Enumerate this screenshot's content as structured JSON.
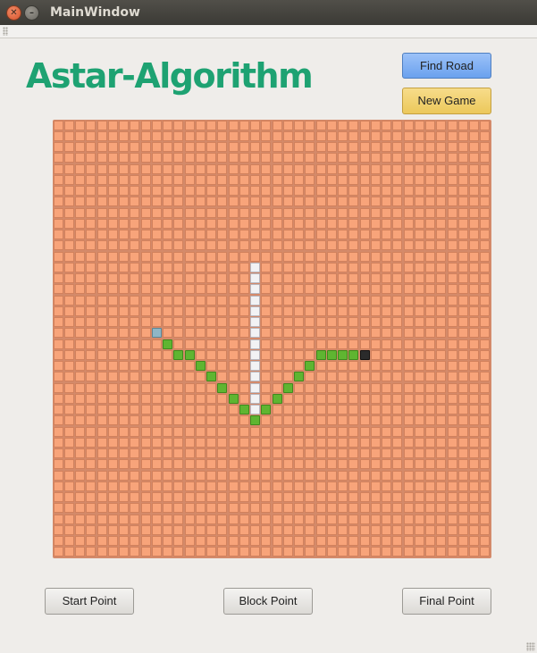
{
  "window": {
    "title": "MainWindow"
  },
  "app": {
    "title": "Astar-Algorithm"
  },
  "buttons": {
    "find_road": "Find Road",
    "new_game": "New Game",
    "start_point": "Start Point",
    "block_point": "Block Point",
    "final_point": "Final Point"
  },
  "colors": {
    "title": "#1ea272",
    "empty_cell": "#f8a47a",
    "path_cell": "#5fb531",
    "block_cell": "#f2f2f4",
    "start_cell": "#8fb6c6",
    "final_cell": "#2b2b2b",
    "find_button": "#6aa1ee",
    "new_game_button": "#ecc85b"
  },
  "grid": {
    "rows": 40,
    "cols": 40,
    "start": [
      19,
      9
    ],
    "final": [
      21,
      28
    ],
    "blocks": [
      [
        13,
        18
      ],
      [
        14,
        18
      ],
      [
        15,
        18
      ],
      [
        16,
        18
      ],
      [
        17,
        18
      ],
      [
        18,
        18
      ],
      [
        19,
        18
      ],
      [
        20,
        18
      ],
      [
        21,
        18
      ],
      [
        22,
        18
      ],
      [
        23,
        18
      ],
      [
        24,
        18
      ],
      [
        25,
        18
      ],
      [
        26,
        18
      ]
    ],
    "path": [
      [
        20,
        10
      ],
      [
        21,
        11
      ],
      [
        21,
        12
      ],
      [
        22,
        13
      ],
      [
        23,
        14
      ],
      [
        24,
        15
      ],
      [
        25,
        16
      ],
      [
        26,
        17
      ],
      [
        27,
        18
      ],
      [
        26,
        19
      ],
      [
        25,
        20
      ],
      [
        24,
        21
      ],
      [
        23,
        22
      ],
      [
        22,
        23
      ],
      [
        21,
        24
      ],
      [
        21,
        25
      ],
      [
        21,
        26
      ],
      [
        21,
        27
      ]
    ]
  }
}
